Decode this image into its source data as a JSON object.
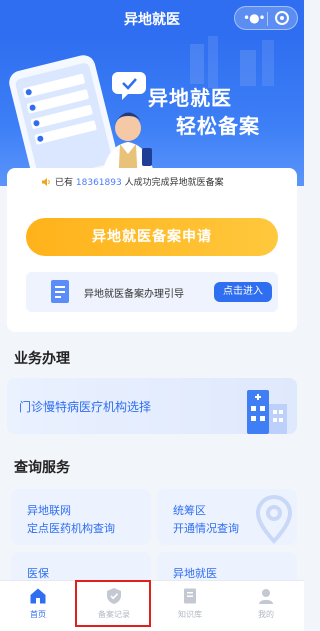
{
  "header": {
    "title": "异地就医"
  },
  "hero": {
    "slogan_line1": "异地就医",
    "slogan_line2": "轻松备案"
  },
  "notice": {
    "prefix": "已有",
    "count": "18361893",
    "suffix": "人成功完成异地就医备案"
  },
  "apply": {
    "label": "异地就医备案申请"
  },
  "guide": {
    "label": "异地就医备案办理引导",
    "button": "点击进入"
  },
  "business": {
    "title": "业务办理",
    "item": "门诊慢特病医疗机构选择"
  },
  "query": {
    "title": "查询服务",
    "cards": [
      {
        "line1": "异地联网",
        "line2": "定点医药机构查询"
      },
      {
        "line1": "统筹区",
        "line2": "开通情况查询"
      },
      {
        "line1": "医保",
        "line2": ""
      },
      {
        "line1": "异地就医",
        "line2": ""
      }
    ]
  },
  "tabbar": {
    "tabs": [
      {
        "label": "首页",
        "icon": "home-icon",
        "active": true
      },
      {
        "label": "备案记录",
        "icon": "record-icon",
        "active": false
      },
      {
        "label": "知识库",
        "icon": "knowledge-icon",
        "active": false
      },
      {
        "label": "我的",
        "icon": "user-icon",
        "active": false
      }
    ]
  },
  "colors": {
    "primary": "#2f6ef0",
    "accent": "#ffb21a",
    "highlight": "#e0201a"
  }
}
